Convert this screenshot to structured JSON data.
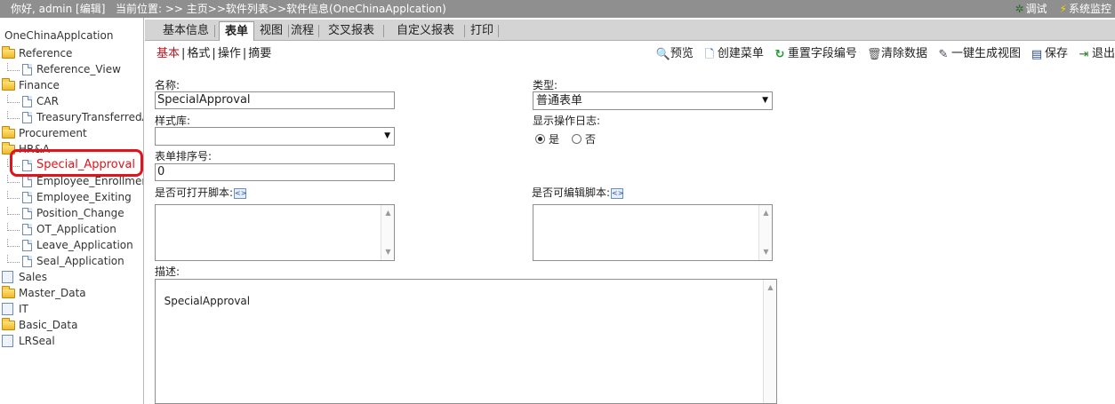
{
  "topbar": {
    "greeting": "你好, admin [编辑]",
    "breadcrumb": "当前位置: >> 主页>>软件列表>>软件信息(OneChinaApplcation)",
    "debug_label": "调试",
    "monitor_label": "系统监控"
  },
  "sidebar": {
    "root": "OneChinaApplcation",
    "items": [
      {
        "label": "Reference",
        "kind": "folder"
      },
      {
        "label": "Reference_View",
        "kind": "page"
      },
      {
        "label": "Finance",
        "kind": "folder"
      },
      {
        "label": "CAR",
        "kind": "page"
      },
      {
        "label": "TreasuryTransferredAp",
        "kind": "page"
      },
      {
        "label": "Procurement",
        "kind": "folder"
      },
      {
        "label": "HR&A",
        "kind": "folder"
      },
      {
        "label": "Special_Approval",
        "kind": "page",
        "selected": true
      },
      {
        "label": "Employee_Enrollment",
        "kind": "page"
      },
      {
        "label": "Employee_Exiting",
        "kind": "page"
      },
      {
        "label": "Position_Change",
        "kind": "page"
      },
      {
        "label": "OT_Application",
        "kind": "page"
      },
      {
        "label": "Leave_Application",
        "kind": "page"
      },
      {
        "label": "Seal_Application",
        "kind": "page"
      },
      {
        "label": "Sales",
        "kind": "blue"
      },
      {
        "label": "Master_Data",
        "kind": "folder"
      },
      {
        "label": "IT",
        "kind": "blue"
      },
      {
        "label": "Basic_Data",
        "kind": "folder"
      },
      {
        "label": "LRSeal",
        "kind": "blue"
      }
    ]
  },
  "tabs": [
    "基本信息",
    "表单",
    "视图",
    "流程",
    "交叉报表",
    "自定义报表",
    "打印"
  ],
  "active_tab": "表单",
  "subnav": [
    "基本",
    "格式",
    "操作",
    "摘要"
  ],
  "actions": {
    "preview": "预览",
    "create_menu": "创建菜单",
    "reset_field_no": "重置字段编号",
    "clear_data": "清除数据",
    "generate_view": "一键生成视图",
    "save": "保存",
    "exit": "退出"
  },
  "form": {
    "name_label": "名称:",
    "name_value": "SpecialApproval",
    "type_label": "类型:",
    "type_value": "普通表单",
    "style_label": "样式库:",
    "style_value": "",
    "show_log_label": "显示操作日志:",
    "show_log_yes": "是",
    "show_log_no": "否",
    "order_label": "表单排序号:",
    "order_value": "0",
    "open_script_label": "是否可打开脚本:",
    "edit_script_label": "是否可编辑脚本:",
    "open_script_value": "",
    "edit_script_value": "",
    "desc_label": "描述:",
    "desc_value": "SpecialApproval"
  },
  "colors": {
    "topbar": "#8f8f8f",
    "highlight": "#e0141c",
    "active_sub": "#c0141c"
  }
}
